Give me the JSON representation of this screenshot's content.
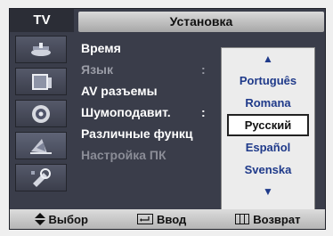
{
  "header": {
    "source": "TV",
    "title": "Установка"
  },
  "menu": {
    "items": [
      {
        "label": "Время",
        "state": "normal"
      },
      {
        "label": "Язык",
        "colon": ":",
        "state": "dim"
      },
      {
        "label": "AV разъемы",
        "state": "normal"
      },
      {
        "label": "Шумоподавит.",
        "colon": ":",
        "state": "normal"
      },
      {
        "label": "Различные функц",
        "state": "normal"
      },
      {
        "label": "Настройка ПК",
        "state": "disabled"
      }
    ]
  },
  "dropdown": {
    "up_arrow": "▲",
    "down_arrow": "▼",
    "options": [
      "Português",
      "Romana",
      "Русский",
      "Español",
      "Svenska"
    ],
    "selected": "Русский"
  },
  "footer": {
    "select_label": "Выбор",
    "enter_label": "Ввод",
    "return_label": "Возврат"
  },
  "icons": [
    "antenna-icon",
    "tv-screen-icon",
    "speaker-icon",
    "satellite-dish-icon",
    "settings-wrench-icon"
  ],
  "colors": {
    "frame": "#3a3d4a",
    "option_text": "#1f3a8a",
    "selected_border": "#222222"
  }
}
